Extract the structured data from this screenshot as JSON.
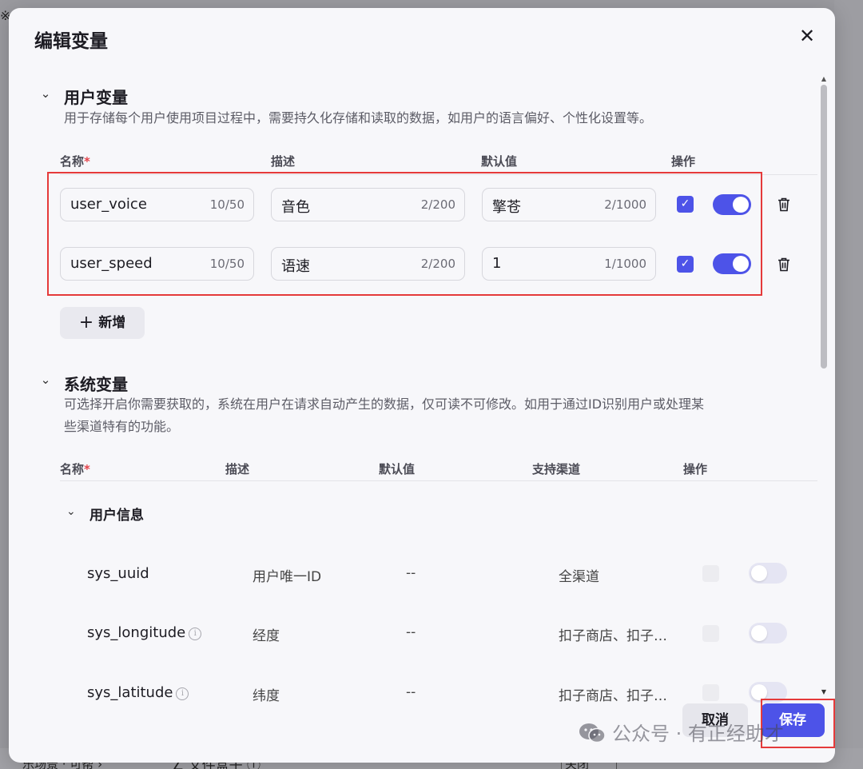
{
  "modal": {
    "title": "编辑变量",
    "close_icon": "close-icon"
  },
  "user_vars": {
    "title": "用户变量",
    "description": "用于存储每个用户使用项目过程中，需要持久化存储和读取的数据，如用户的语言偏好、个性化设置等。",
    "headers": {
      "name": "名称",
      "required": "*",
      "desc": "描述",
      "default": "默认值",
      "action": "操作"
    },
    "rows": [
      {
        "name": "user_voice",
        "name_count": "10/50",
        "desc": "音色",
        "desc_count": "2/200",
        "default": "擎苍",
        "default_count": "2/1000",
        "checked": true,
        "enabled": true
      },
      {
        "name": "user_speed",
        "name_count": "10/50",
        "desc": "语速",
        "desc_count": "2/200",
        "default": "1",
        "default_count": "1/1000",
        "checked": true,
        "enabled": true
      }
    ],
    "add_label": "新增"
  },
  "system_vars": {
    "title": "系统变量",
    "description_line1": "可选择开启你需要获取的，系统在用户在请求自动产生的数据，仅可读不可修改。如用于通过ID识别用户或处理某",
    "description_line2": "些渠道特有的功能。",
    "headers": {
      "name": "名称",
      "required": "*",
      "desc": "描述",
      "default": "默认值",
      "channel": "支持渠道",
      "action": "操作"
    },
    "group_title": "用户信息",
    "rows": [
      {
        "name": "sys_uuid",
        "desc": "用户唯一ID",
        "default": "--",
        "channel": "全渠道",
        "info": false,
        "enabled": false
      },
      {
        "name": "sys_longitude",
        "desc": "经度",
        "default": "--",
        "channel": "扣子商店、扣子…",
        "info": true,
        "enabled": false
      },
      {
        "name": "sys_latitude",
        "desc": "纬度",
        "default": "--",
        "channel": "扣子商店、扣子…",
        "info": true,
        "enabled": false
      }
    ]
  },
  "footer": {
    "cancel_label": "取消",
    "save_label": "保存"
  },
  "watermark": {
    "text": "公众号 · 有正经助才"
  },
  "background": {
    "bottom_left": "乐场景 · 可帮 ›",
    "bottom_mid": "∠ 文件盒子 ⓘ",
    "bottom_right": "关闭"
  },
  "colors": {
    "accent": "#4d53e8",
    "highlight": "#e53a3a",
    "modal_bg": "#f7f7fa"
  }
}
